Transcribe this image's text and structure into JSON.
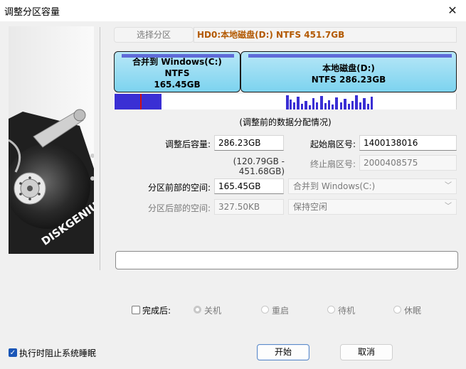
{
  "window": {
    "title": "调整分区容量",
    "close_glyph": "✕"
  },
  "logo": {
    "brand": "DISKGENIUS"
  },
  "header": {
    "select_partition_button": "选择分区",
    "disk_info": "HD0:本地磁盘(D:) NTFS 451.7GB"
  },
  "partitions": [
    {
      "name": "合并到 Windows(C:)",
      "fs": "NTFS",
      "size": "165.45GB"
    },
    {
      "name": "本地磁盘(D:)",
      "fs": "NTFS 286.23GB"
    }
  ],
  "distribution_caption": "(调整前的数据分配情况)",
  "fields": {
    "new_size_label": "调整后容量:",
    "new_size_value": "286.23GB",
    "size_range": "(120.79GB - 451.68GB)",
    "start_sector_label": "起始扇区号:",
    "start_sector_value": "1400138016",
    "end_sector_label": "终止扇区号:",
    "end_sector_value": "2000408575",
    "space_before_label": "分区前部的空间:",
    "space_before_value": "165.45GB",
    "space_before_option": "合并到 Windows(C:)",
    "space_after_label": "分区后部的空间:",
    "space_after_value": "327.50KB",
    "space_after_option": "保持空闲"
  },
  "progress": {
    "value": 0
  },
  "after_completion": {
    "label": "完成后:",
    "options": [
      "关机",
      "重启",
      "待机",
      "休眠"
    ]
  },
  "prevent_sleep_label": "执行时阻止系统睡眠",
  "buttons": {
    "start": "开始",
    "cancel": "取消"
  },
  "colors": {
    "accent": "#1a56b7",
    "disk_info_text": "#b35900",
    "partition_fill": "#7cd3ef",
    "data_bar": "#3a2fd4"
  }
}
